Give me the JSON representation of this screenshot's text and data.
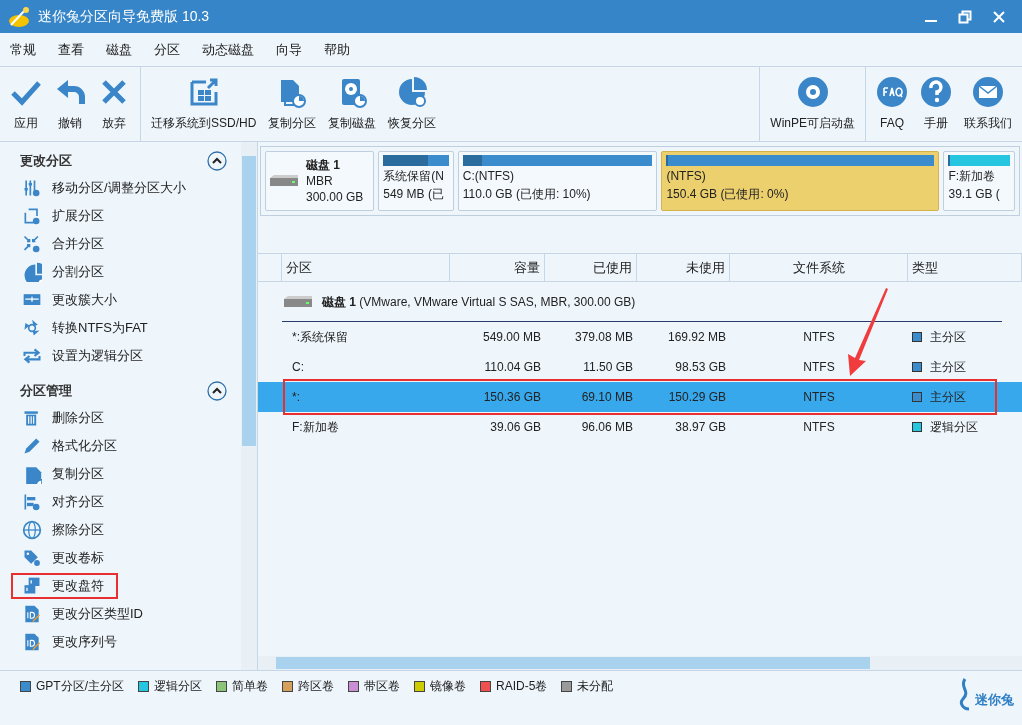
{
  "window": {
    "title": "迷你兔分区向导免费版 10.3"
  },
  "menu": [
    "常规",
    "查看",
    "磁盘",
    "分区",
    "动态磁盘",
    "向导",
    "帮助"
  ],
  "toolbar": [
    [
      {
        "label": "应用",
        "kind": "check"
      },
      {
        "label": "撤销",
        "kind": "undo"
      },
      {
        "label": "放弃",
        "kind": "cross"
      }
    ],
    [
      {
        "label": "迁移系统到SSD/HD",
        "kind": "migrate"
      },
      {
        "label": "复制分区",
        "kind": "copy"
      },
      {
        "label": "复制磁盘",
        "kind": "disk"
      },
      {
        "label": "恢复分区",
        "kind": "pie"
      }
    ],
    [
      {
        "label": "WinPE可启动盘",
        "kind": "disc"
      }
    ],
    [
      {
        "label": "FAQ",
        "kind": "faq"
      },
      {
        "label": "手册",
        "kind": "help"
      },
      {
        "label": "联系我们",
        "kind": "mail"
      }
    ]
  ],
  "sidebar": {
    "sections": [
      {
        "title": "更改分区",
        "expanded": true,
        "items": [
          {
            "label": "移动分区/调整分区大小",
            "kind": "sliders",
            "marked": false
          },
          {
            "label": "扩展分区",
            "kind": "frame",
            "marked": false
          },
          {
            "label": "合并分区",
            "kind": "arrows",
            "marked": false
          },
          {
            "label": "分割分区",
            "kind": "pie",
            "marked": false
          },
          {
            "label": "更改簇大小",
            "kind": "ruler",
            "marked": false
          },
          {
            "label": "转换NTFS为FAT",
            "kind": "recycle",
            "marked": false
          },
          {
            "label": "设置为逻辑分区",
            "kind": "swap",
            "marked": false
          }
        ]
      },
      {
        "title": "分区管理",
        "expanded": true,
        "items": [
          {
            "label": "删除分区",
            "kind": "trash",
            "marked": false
          },
          {
            "label": "格式化分区",
            "kind": "pencil",
            "marked": false
          },
          {
            "label": "复制分区",
            "kind": "copy",
            "marked": false
          },
          {
            "label": "对齐分区",
            "kind": "align",
            "marked": false
          },
          {
            "label": "擦除分区",
            "kind": "globe",
            "marked": false
          },
          {
            "label": "更改卷标",
            "kind": "tag",
            "marked": false
          },
          {
            "label": "更改盘符",
            "kind": "letter",
            "marked": true
          },
          {
            "label": "更改分区类型ID",
            "kind": "id",
            "marked": false
          },
          {
            "label": "更改序列号",
            "kind": "id",
            "marked": false
          }
        ]
      }
    ]
  },
  "disk_map": {
    "name": "磁盘 1",
    "scheme": "MBR",
    "size": "300.00 GB",
    "partitions": [
      {
        "label": "系统保留(N",
        "detail": "549 MB (已",
        "level": 0.69,
        "color": "#3a8ccc",
        "selected": false
      },
      {
        "label": "C:(NTFS)",
        "detail": "110.0 GB (已使用: 10%)",
        "level": 0.1,
        "color": "#3a8ccc",
        "selected": false
      },
      {
        "label": "(NTFS)",
        "detail": "150.4 GB (已使用: 0%)",
        "level": 0.0,
        "color": "#3a8ccc",
        "selected": true
      },
      {
        "label": "F:新加卷",
        "detail": "39.1 GB (",
        "level": 0.0,
        "color": "#26c6e0",
        "selected": false
      }
    ]
  },
  "table": {
    "columns": [
      "分区",
      "容量",
      "已使用",
      "未使用",
      "文件系统",
      "类型"
    ],
    "disk_row": {
      "name": "磁盘 1",
      "detail": "(VMware, VMware Virtual S SAS, MBR, 300.00 GB)"
    },
    "rows": [
      {
        "cells": [
          "*:系统保留",
          "549.00 MB",
          "379.08 MB",
          "169.92 MB",
          "NTFS",
          "主分区"
        ],
        "color": "#3a8ccc",
        "selected": false,
        "marked": false
      },
      {
        "cells": [
          "C:",
          "110.04 GB",
          "11.50 GB",
          "98.53 GB",
          "NTFS",
          "主分区"
        ],
        "color": "#3a8ccc",
        "selected": false,
        "marked": false
      },
      {
        "cells": [
          "*:",
          "150.36 GB",
          "69.10 MB",
          "150.29 GB",
          "NTFS",
          "主分区"
        ],
        "color": "#3a8ccc",
        "selected": true,
        "marked": true
      },
      {
        "cells": [
          "F:新加卷",
          "39.06 GB",
          "96.06 MB",
          "38.97 GB",
          "NTFS",
          "逻辑分区"
        ],
        "color": "#26c6e0",
        "selected": false,
        "marked": false
      }
    ]
  },
  "legend": [
    {
      "label": "GPT分区/主分区",
      "color": "#3a8ccc"
    },
    {
      "label": "逻辑分区",
      "color": "#26c6e0"
    },
    {
      "label": "简单卷",
      "color": "#8cc47a"
    },
    {
      "label": "跨区卷",
      "color": "#d4a05a"
    },
    {
      "label": "带区卷",
      "color": "#c98ed6"
    },
    {
      "label": "镜像卷",
      "color": "#cccc00"
    },
    {
      "label": "RAID-5卷",
      "color": "#f05050"
    },
    {
      "label": "未分配",
      "color": "#9a9a9a"
    }
  ],
  "brand": "迷你兔"
}
